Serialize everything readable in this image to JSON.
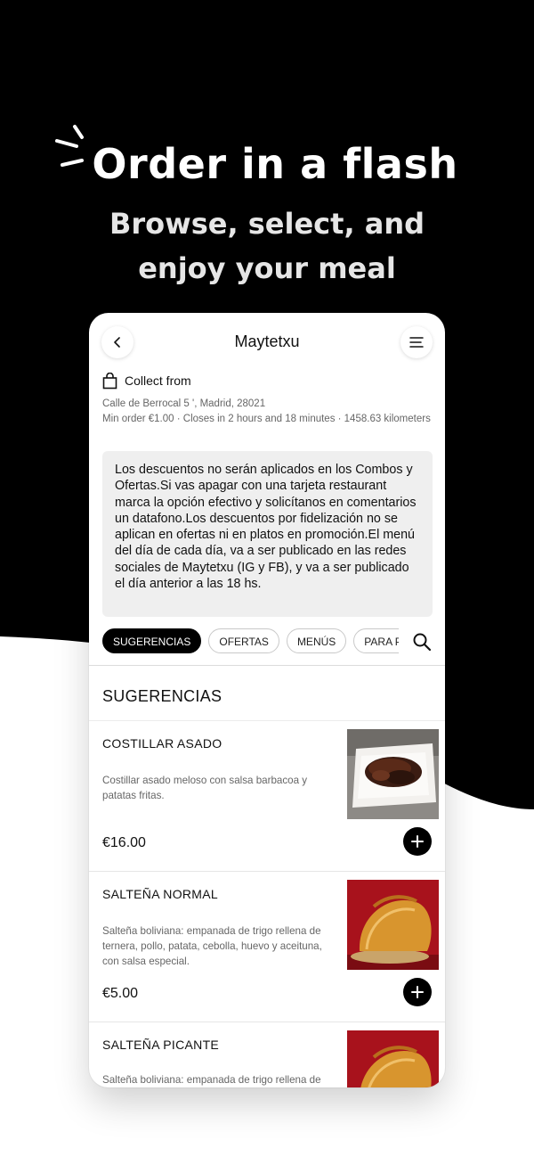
{
  "hero": {
    "headline": "Order in a flash",
    "subline_1": "Browse, select, and",
    "subline_2": "enjoy your meal"
  },
  "store": {
    "name": "Maytetxu",
    "collect_label": "Collect from",
    "address": "Calle de Berrocal 5 ', Madrid, 28021",
    "info": "Min order €1.00 · Closes in 2 hours and 18 minutes · 1458.63 kilometers",
    "notice": "Los descuentos no serán aplicados en los Combos y Ofertas.Si vas apagar con una tarjeta restaurant marca la opción efectivo y solicítanos en comentarios un datafono.Los descuentos por fidelización no se aplican en ofertas ni en platos en promoción.El menú del día de cada día, va a ser publicado en las redes sociales de Maytetxu (IG y FB), y va a ser publicado el día anterior a las 18 hs."
  },
  "categories": [
    "SUGERENCIAS",
    "OFERTAS",
    "MENÚS",
    "PARA PICAR"
  ],
  "active_category": "SUGERENCIAS",
  "section_title": "SUGERENCIAS",
  "items": [
    {
      "name": "COSTILLAR ASADO",
      "description": "Costillar asado meloso con salsa barbacoa y patatas fritas.",
      "price": "€16.00"
    },
    {
      "name": "SALTEÑA NORMAL",
      "description": "Salteña boliviana: empanada de trigo rellena de ternera, pollo, patata, cebolla, huevo y aceituna, con salsa especial.",
      "price": "€5.00"
    },
    {
      "name": "SALTEÑA PICANTE",
      "description": "Salteña boliviana: empanada de trigo rellena de",
      "price": ""
    }
  ],
  "icons": {
    "back": "chevron-left-icon",
    "menu": "menu-icon",
    "bag": "shopping-bag-icon",
    "search": "search-icon",
    "add": "plus-icon"
  },
  "colors": {
    "background_dark": "#000000",
    "accent": "#000000",
    "notice_bg": "#efefef"
  }
}
